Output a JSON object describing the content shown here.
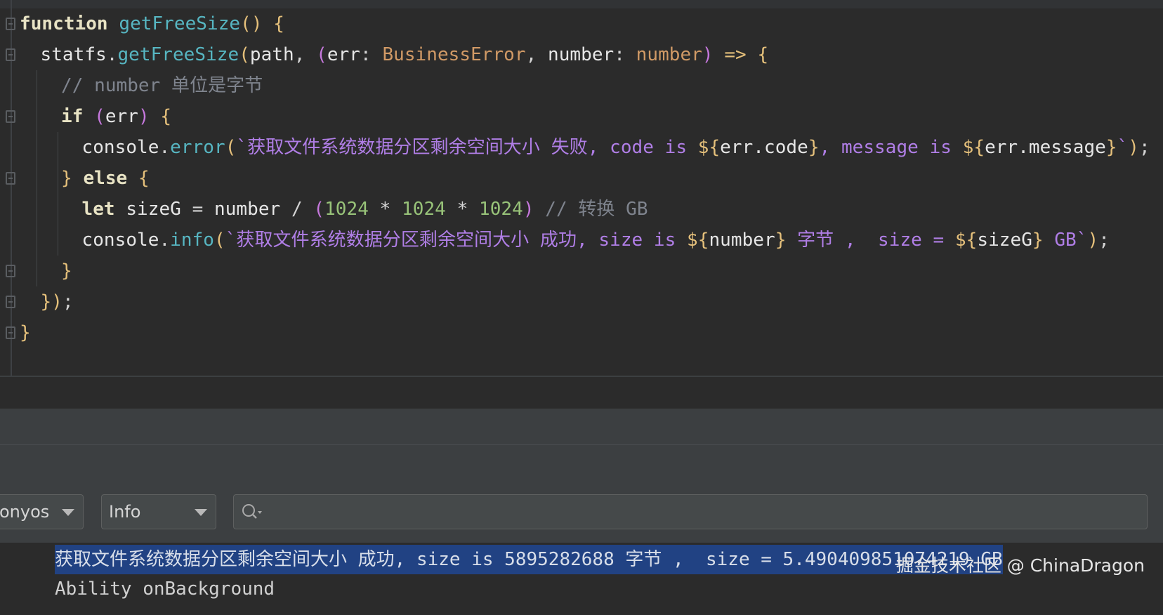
{
  "editor": {
    "lines": [
      {
        "indent": 0,
        "fold": true,
        "tokens": [
          {
            "c": "kw",
            "t": "function"
          },
          {
            "c": "punc",
            "t": " "
          },
          {
            "c": "fn",
            "t": "getFreeSize"
          },
          {
            "c": "paren",
            "t": "()"
          },
          {
            "c": "punc",
            "t": " "
          },
          {
            "c": "paren",
            "t": "{"
          }
        ]
      },
      {
        "indent": 1,
        "fold": true,
        "tokens": [
          {
            "c": "var",
            "t": "statfs"
          },
          {
            "c": "punc",
            "t": "."
          },
          {
            "c": "fn",
            "t": "getFreeSize"
          },
          {
            "c": "paren",
            "t": "("
          },
          {
            "c": "var",
            "t": "path"
          },
          {
            "c": "punc",
            "t": ", "
          },
          {
            "c": "paren2",
            "t": "("
          },
          {
            "c": "var",
            "t": "err"
          },
          {
            "c": "punc",
            "t": ": "
          },
          {
            "c": "type",
            "t": "BusinessError"
          },
          {
            "c": "punc",
            "t": ", "
          },
          {
            "c": "var",
            "t": "number"
          },
          {
            "c": "punc",
            "t": ": "
          },
          {
            "c": "type",
            "t": "number"
          },
          {
            "c": "paren2",
            "t": ")"
          },
          {
            "c": "punc",
            "t": " "
          },
          {
            "c": "paren",
            "t": "=>"
          },
          {
            "c": "punc",
            "t": " "
          },
          {
            "c": "paren",
            "t": "{"
          }
        ]
      },
      {
        "indent": 2,
        "fold": false,
        "tokens": [
          {
            "c": "cm",
            "t": "// number 单位是字节"
          }
        ]
      },
      {
        "indent": 2,
        "fold": true,
        "tokens": [
          {
            "c": "kw",
            "t": "if"
          },
          {
            "c": "punc",
            "t": " "
          },
          {
            "c": "paren2",
            "t": "("
          },
          {
            "c": "var",
            "t": "err"
          },
          {
            "c": "paren2",
            "t": ")"
          },
          {
            "c": "punc",
            "t": " "
          },
          {
            "c": "paren",
            "t": "{"
          }
        ]
      },
      {
        "indent": 3,
        "fold": false,
        "tokens": [
          {
            "c": "var",
            "t": "console"
          },
          {
            "c": "punc",
            "t": "."
          },
          {
            "c": "meth",
            "t": "error"
          },
          {
            "c": "paren",
            "t": "("
          },
          {
            "c": "str",
            "t": "`获取文件系统数据分区剩余空间大小 失败, code is "
          },
          {
            "c": "tpl",
            "t": "${"
          },
          {
            "c": "var",
            "t": "err.code"
          },
          {
            "c": "tpl",
            "t": "}"
          },
          {
            "c": "str",
            "t": ", message is "
          },
          {
            "c": "tpl",
            "t": "${"
          },
          {
            "c": "var",
            "t": "err.message"
          },
          {
            "c": "tpl",
            "t": "}"
          },
          {
            "c": "str",
            "t": "`"
          },
          {
            "c": "paren",
            "t": ")"
          },
          {
            "c": "punc",
            "t": ";"
          }
        ]
      },
      {
        "indent": 2,
        "fold": true,
        "tokens": [
          {
            "c": "paren",
            "t": "}"
          },
          {
            "c": "punc",
            "t": " "
          },
          {
            "c": "kw",
            "t": "else"
          },
          {
            "c": "punc",
            "t": " "
          },
          {
            "c": "paren",
            "t": "{"
          }
        ]
      },
      {
        "indent": 3,
        "fold": false,
        "tokens": [
          {
            "c": "kw",
            "t": "let"
          },
          {
            "c": "punc",
            "t": " "
          },
          {
            "c": "var",
            "t": "sizeG"
          },
          {
            "c": "punc",
            "t": " = "
          },
          {
            "c": "var",
            "t": "number"
          },
          {
            "c": "punc",
            "t": " / "
          },
          {
            "c": "paren2",
            "t": "("
          },
          {
            "c": "num",
            "t": "1024"
          },
          {
            "c": "punc",
            "t": " * "
          },
          {
            "c": "num",
            "t": "1024"
          },
          {
            "c": "punc",
            "t": " * "
          },
          {
            "c": "num",
            "t": "1024"
          },
          {
            "c": "paren2",
            "t": ")"
          },
          {
            "c": "punc",
            "t": " "
          },
          {
            "c": "cm",
            "t": "// 转换 GB"
          }
        ]
      },
      {
        "indent": 3,
        "fold": false,
        "tokens": [
          {
            "c": "var",
            "t": "console"
          },
          {
            "c": "punc",
            "t": "."
          },
          {
            "c": "meth",
            "t": "info"
          },
          {
            "c": "paren",
            "t": "("
          },
          {
            "c": "str",
            "t": "`获取文件系统数据分区剩余空间大小 成功, size is "
          },
          {
            "c": "tpl",
            "t": "${"
          },
          {
            "c": "var",
            "t": "number"
          },
          {
            "c": "tpl",
            "t": "}"
          },
          {
            "c": "str",
            "t": " 字节 ,  size = "
          },
          {
            "c": "tpl",
            "t": "${"
          },
          {
            "c": "var",
            "t": "sizeG"
          },
          {
            "c": "tpl",
            "t": "}"
          },
          {
            "c": "str",
            "t": " GB`"
          },
          {
            "c": "paren",
            "t": ")"
          },
          {
            "c": "punc",
            "t": ";"
          }
        ]
      },
      {
        "indent": 2,
        "fold": true,
        "tokens": [
          {
            "c": "paren",
            "t": "}"
          }
        ]
      },
      {
        "indent": 1,
        "fold": true,
        "tokens": [
          {
            "c": "paren",
            "t": "}"
          },
          {
            "c": "paren",
            "t": ")"
          },
          {
            "c": "punc",
            "t": ";"
          }
        ]
      },
      {
        "indent": 0,
        "fold": true,
        "tokens": [
          {
            "c": "paren",
            "t": "}"
          }
        ]
      }
    ]
  },
  "toolbar": {
    "device_value": "onyos",
    "level_value": "Info",
    "search_value": ""
  },
  "log": {
    "lines": [
      {
        "text": "获取文件系统数据分区剩余空间大小 成功, size is 5895282688 字节 ,  size = 5.490409851074219 GB",
        "selected": true
      },
      {
        "text": "Ability onBackground",
        "selected": false
      }
    ]
  },
  "watermark": "掘金技术社区 @ ChinaDragon",
  "colors": {
    "editor_bg": "#2b2b2b",
    "panel_bg": "#3c3f41",
    "selection": "#214283",
    "string": "#b07ee6",
    "function": "#57b6c2",
    "type": "#d19a66",
    "number": "#98c379",
    "bracket": "#e5c07b",
    "comment": "#7f848e"
  }
}
